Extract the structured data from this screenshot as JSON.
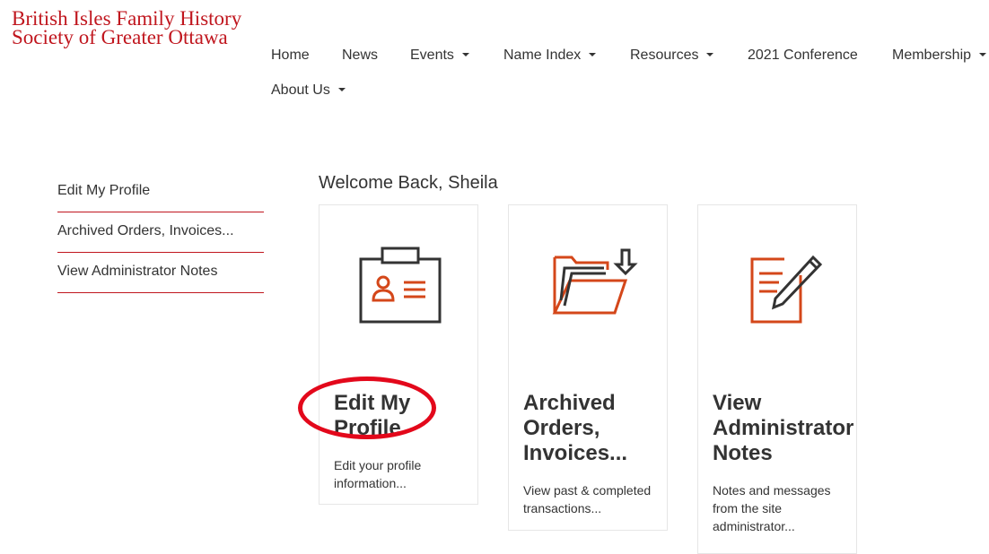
{
  "site": {
    "logo_line1": "British Isles Family History",
    "logo_line2": "Society of Greater Ottawa"
  },
  "nav": {
    "items": [
      {
        "label": "Home"
      },
      {
        "label": "News"
      },
      {
        "label": "Events"
      },
      {
        "label": "Name Index"
      },
      {
        "label": "Resources"
      },
      {
        "label": "2021 Conference"
      },
      {
        "label": "Membership"
      },
      {
        "label": "About Us"
      }
    ]
  },
  "sidebar": {
    "items": [
      {
        "label": "Edit My Profile"
      },
      {
        "label": "Archived Orders, Invoices..."
      },
      {
        "label": "View Administrator Notes"
      }
    ]
  },
  "main": {
    "welcome": "Welcome Back, Sheila",
    "cards": [
      {
        "title": "Edit My Profile",
        "desc": "Edit your profile information...",
        "icon": "id-badge-icon"
      },
      {
        "title": "Archived Orders, Invoices...",
        "desc": "View past & completed transactions...",
        "icon": "folder-download-icon"
      },
      {
        "title": "View Administrator Notes",
        "desc": "Notes and messages from the site administrator...",
        "icon": "note-edit-icon"
      }
    ]
  },
  "colors": {
    "brand_red": "#c0161e",
    "icon_orange": "#d4471a",
    "icon_dark": "#333333",
    "annotation_red": "#e3081b"
  }
}
